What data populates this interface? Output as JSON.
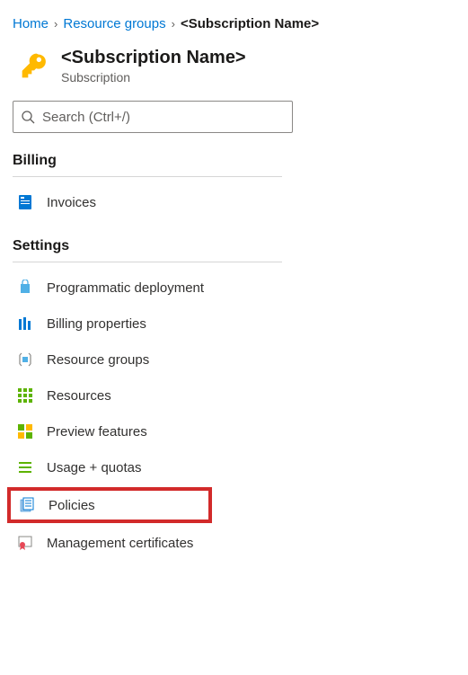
{
  "breadcrumb": {
    "home": "Home",
    "resource_groups": "Resource groups",
    "current": "<Subscription Name>"
  },
  "header": {
    "title": "<Subscription Name>",
    "subtitle": "Subscription"
  },
  "search": {
    "placeholder": "Search (Ctrl+/)"
  },
  "sections": {
    "billing": {
      "title": "Billing",
      "items": [
        {
          "label": "Invoices"
        }
      ]
    },
    "settings": {
      "title": "Settings",
      "items": [
        {
          "label": "Programmatic deployment"
        },
        {
          "label": "Billing properties"
        },
        {
          "label": "Resource groups"
        },
        {
          "label": "Resources"
        },
        {
          "label": "Preview features"
        },
        {
          "label": "Usage + quotas"
        },
        {
          "label": "Policies"
        },
        {
          "label": "Management certificates"
        }
      ]
    }
  },
  "highlighted_item": "Policies"
}
